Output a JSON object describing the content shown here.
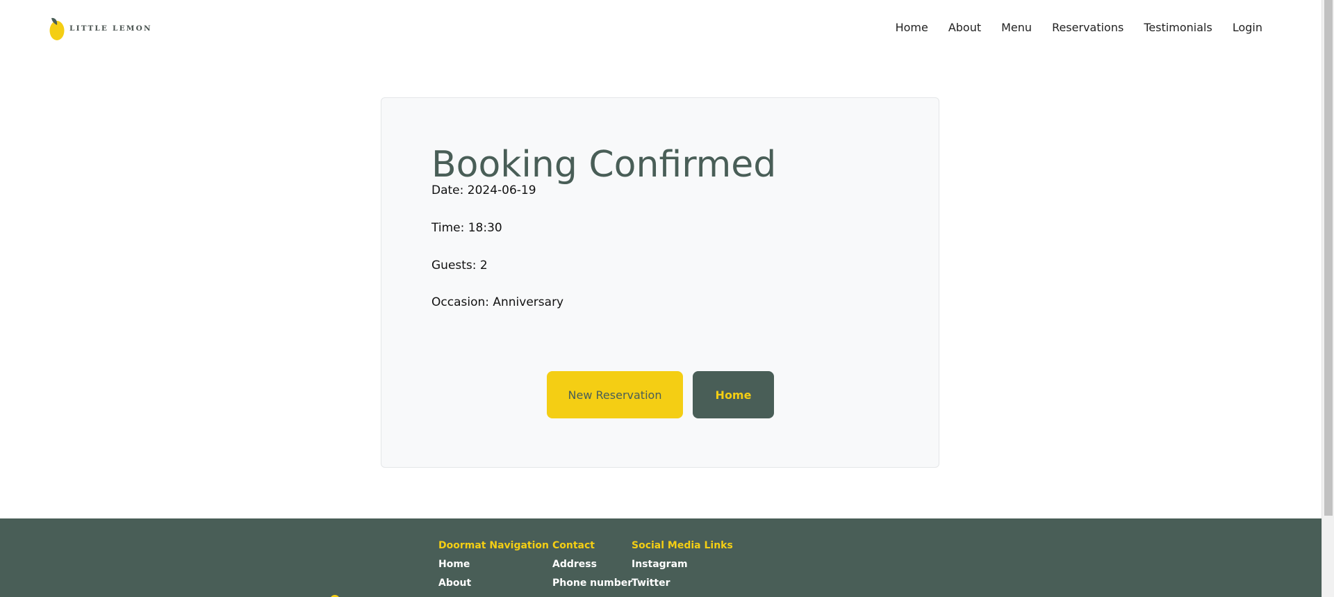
{
  "header": {
    "logo_text": "LITTLE LEMON",
    "nav": [
      {
        "label": "Home",
        "icon": ""
      },
      {
        "label": "About"
      },
      {
        "label": "Menu"
      },
      {
        "label": "Reservations"
      },
      {
        "label": "Testimonials"
      },
      {
        "label": "Login"
      }
    ]
  },
  "confirmation": {
    "title": "Booking Confirmed",
    "date": "Date: 2024-06-19",
    "time": "Time: 18:30",
    "guests": "Guests: 2",
    "occasion": "Occasion: Anniversary",
    "new_reservation_label": "New Reservation",
    "home_label": "Home"
  },
  "footer": {
    "columns": [
      {
        "heading": "Doormat Navigation",
        "links": [
          "Home",
          "About"
        ]
      },
      {
        "heading": "Contact",
        "links": [
          "Address",
          "Phone number"
        ]
      },
      {
        "heading": "Social Media Links",
        "links": [
          "Instagram",
          "Twitter"
        ]
      }
    ]
  },
  "colors": {
    "primary_green": "#495e57",
    "primary_yellow": "#f4ce14",
    "card_background": "#f8f9fa"
  },
  "icons": {
    "logo": "lemon-icon"
  }
}
